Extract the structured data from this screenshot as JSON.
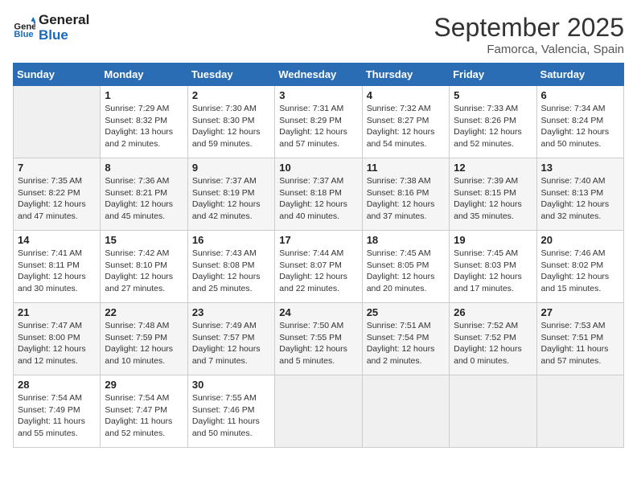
{
  "logo": {
    "line1": "General",
    "line2": "Blue"
  },
  "title": {
    "month_year": "September 2025",
    "location": "Famorca, Valencia, Spain"
  },
  "days_of_week": [
    "Sunday",
    "Monday",
    "Tuesday",
    "Wednesday",
    "Thursday",
    "Friday",
    "Saturday"
  ],
  "weeks": [
    [
      {
        "num": "",
        "info": ""
      },
      {
        "num": "1",
        "info": "Sunrise: 7:29 AM\nSunset: 8:32 PM\nDaylight: 13 hours and 2 minutes."
      },
      {
        "num": "2",
        "info": "Sunrise: 7:30 AM\nSunset: 8:30 PM\nDaylight: 12 hours and 59 minutes."
      },
      {
        "num": "3",
        "info": "Sunrise: 7:31 AM\nSunset: 8:29 PM\nDaylight: 12 hours and 57 minutes."
      },
      {
        "num": "4",
        "info": "Sunrise: 7:32 AM\nSunset: 8:27 PM\nDaylight: 12 hours and 54 minutes."
      },
      {
        "num": "5",
        "info": "Sunrise: 7:33 AM\nSunset: 8:26 PM\nDaylight: 12 hours and 52 minutes."
      },
      {
        "num": "6",
        "info": "Sunrise: 7:34 AM\nSunset: 8:24 PM\nDaylight: 12 hours and 50 minutes."
      }
    ],
    [
      {
        "num": "7",
        "info": "Sunrise: 7:35 AM\nSunset: 8:22 PM\nDaylight: 12 hours and 47 minutes."
      },
      {
        "num": "8",
        "info": "Sunrise: 7:36 AM\nSunset: 8:21 PM\nDaylight: 12 hours and 45 minutes."
      },
      {
        "num": "9",
        "info": "Sunrise: 7:37 AM\nSunset: 8:19 PM\nDaylight: 12 hours and 42 minutes."
      },
      {
        "num": "10",
        "info": "Sunrise: 7:37 AM\nSunset: 8:18 PM\nDaylight: 12 hours and 40 minutes."
      },
      {
        "num": "11",
        "info": "Sunrise: 7:38 AM\nSunset: 8:16 PM\nDaylight: 12 hours and 37 minutes."
      },
      {
        "num": "12",
        "info": "Sunrise: 7:39 AM\nSunset: 8:15 PM\nDaylight: 12 hours and 35 minutes."
      },
      {
        "num": "13",
        "info": "Sunrise: 7:40 AM\nSunset: 8:13 PM\nDaylight: 12 hours and 32 minutes."
      }
    ],
    [
      {
        "num": "14",
        "info": "Sunrise: 7:41 AM\nSunset: 8:11 PM\nDaylight: 12 hours and 30 minutes."
      },
      {
        "num": "15",
        "info": "Sunrise: 7:42 AM\nSunset: 8:10 PM\nDaylight: 12 hours and 27 minutes."
      },
      {
        "num": "16",
        "info": "Sunrise: 7:43 AM\nSunset: 8:08 PM\nDaylight: 12 hours and 25 minutes."
      },
      {
        "num": "17",
        "info": "Sunrise: 7:44 AM\nSunset: 8:07 PM\nDaylight: 12 hours and 22 minutes."
      },
      {
        "num": "18",
        "info": "Sunrise: 7:45 AM\nSunset: 8:05 PM\nDaylight: 12 hours and 20 minutes."
      },
      {
        "num": "19",
        "info": "Sunrise: 7:45 AM\nSunset: 8:03 PM\nDaylight: 12 hours and 17 minutes."
      },
      {
        "num": "20",
        "info": "Sunrise: 7:46 AM\nSunset: 8:02 PM\nDaylight: 12 hours and 15 minutes."
      }
    ],
    [
      {
        "num": "21",
        "info": "Sunrise: 7:47 AM\nSunset: 8:00 PM\nDaylight: 12 hours and 12 minutes."
      },
      {
        "num": "22",
        "info": "Sunrise: 7:48 AM\nSunset: 7:59 PM\nDaylight: 12 hours and 10 minutes."
      },
      {
        "num": "23",
        "info": "Sunrise: 7:49 AM\nSunset: 7:57 PM\nDaylight: 12 hours and 7 minutes."
      },
      {
        "num": "24",
        "info": "Sunrise: 7:50 AM\nSunset: 7:55 PM\nDaylight: 12 hours and 5 minutes."
      },
      {
        "num": "25",
        "info": "Sunrise: 7:51 AM\nSunset: 7:54 PM\nDaylight: 12 hours and 2 minutes."
      },
      {
        "num": "26",
        "info": "Sunrise: 7:52 AM\nSunset: 7:52 PM\nDaylight: 12 hours and 0 minutes."
      },
      {
        "num": "27",
        "info": "Sunrise: 7:53 AM\nSunset: 7:51 PM\nDaylight: 11 hours and 57 minutes."
      }
    ],
    [
      {
        "num": "28",
        "info": "Sunrise: 7:54 AM\nSunset: 7:49 PM\nDaylight: 11 hours and 55 minutes."
      },
      {
        "num": "29",
        "info": "Sunrise: 7:54 AM\nSunset: 7:47 PM\nDaylight: 11 hours and 52 minutes."
      },
      {
        "num": "30",
        "info": "Sunrise: 7:55 AM\nSunset: 7:46 PM\nDaylight: 11 hours and 50 minutes."
      },
      {
        "num": "",
        "info": ""
      },
      {
        "num": "",
        "info": ""
      },
      {
        "num": "",
        "info": ""
      },
      {
        "num": "",
        "info": ""
      }
    ]
  ]
}
